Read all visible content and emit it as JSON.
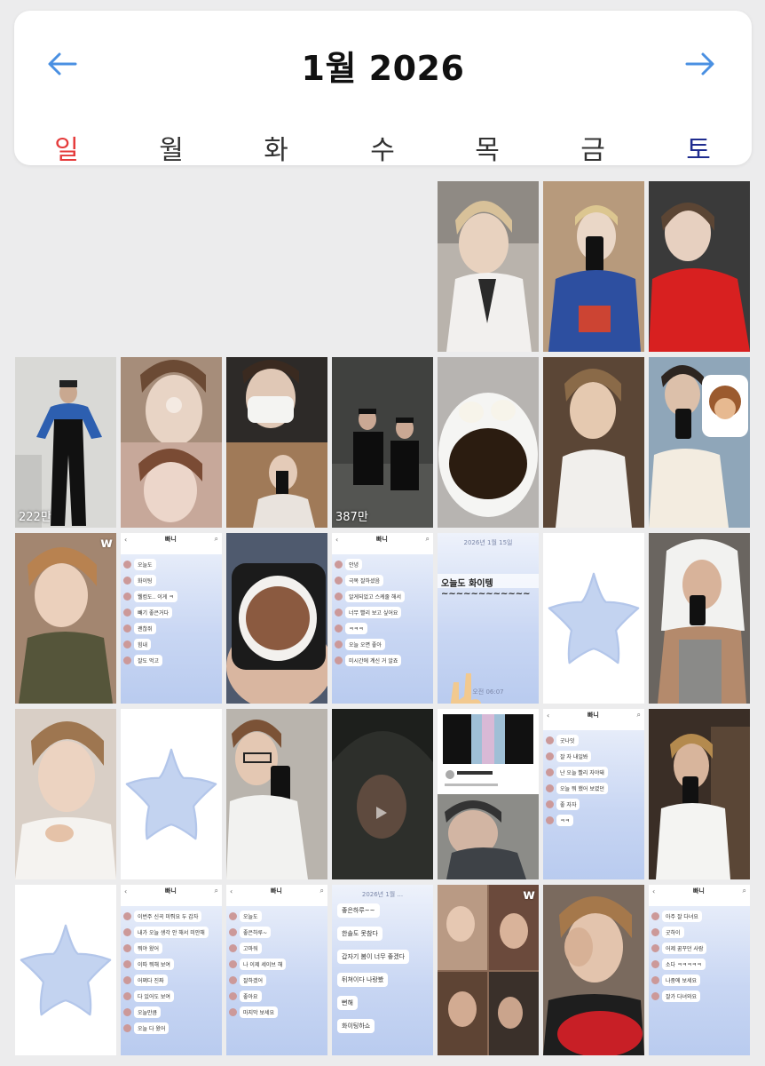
{
  "header": {
    "title": "1월 2026",
    "prev_icon": "arrow-left-icon",
    "next_icon": "arrow-right-icon",
    "accent": "#4a90e2",
    "weekdays": [
      "일",
      "월",
      "화",
      "수",
      "목",
      "금",
      "토"
    ]
  },
  "cells": {
    "c2_1_views": "222만",
    "c2_4_views": "387만",
    "c3_1_badge": "w",
    "c5_5_badge": "w",
    "c5_4_date": "2026년 1월 ...",
    "c3_5_date": "2026년 1월 15일",
    "c3_5_header": "오늘도 화이텡~~~~~~~~~~~~",
    "c3_5_time": "오전 06:07",
    "chat_title": "빠니",
    "chat1": [
      "오늘도",
      "화이팅",
      "웰컴도.. 이게 ㅋ",
      "빼기 좋은거다",
      "괜찮쥐",
      "힘내",
      "잘도 먹고"
    ],
    "chat2": [
      "안녕",
      "극복 잘하셨음",
      "알게되었고 스케줄 해서",
      "너무 빨리 보고 싶어요",
      "ㅋㅋㅋ",
      "오늘 오면 좋아",
      "미시간에 계신 거 알죠"
    ],
    "chat3": [
      "굿나잇",
      "잘 자 내일봐",
      "난 오늘 빨리 자야돼",
      "오늘 뭐 했어 보였던",
      "좋 자자",
      "ㅋㅋ"
    ],
    "chat4": [
      "이번주 신곡 미뤄요 두 갑자",
      "내가 오늘 생각 안 해서 미안해",
      "뭐야 왔어",
      "이따 뭐해 보여",
      "어쩌다 진짜",
      "다 있어도 보여",
      "오늘만큼",
      "오늘 다 왔어"
    ],
    "chat5": [
      "오늘도",
      "좋은하루~",
      "고마워",
      "나 이제 세이브 해",
      "잘하겠어",
      "좋아요",
      "마지막 보세요"
    ],
    "chat6": [
      "좋은하루~~",
      "한솔도 못참다",
      "갑자기 봄이 너무 좋겠다",
      "뒤쳐이다 나랑봤",
      "뻔해",
      "화이팅하쇼"
    ],
    "chat7": [
      "아주 잘 다녀요",
      "굿하이",
      "어제 꿈꾸던 사람",
      "소다 ㅋㅋㅋㅋㅋ",
      "나중에 보세요",
      "잘가 다녀와요"
    ]
  }
}
